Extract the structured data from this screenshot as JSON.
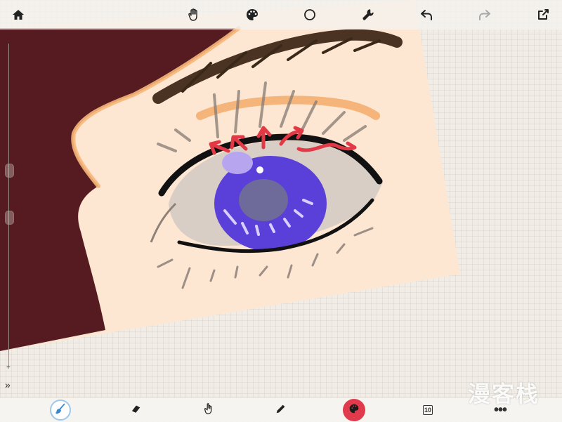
{
  "app": {
    "name": ""
  },
  "toolbar_top": {
    "icons": [
      "home-icon",
      "hand-icon",
      "palette-icon",
      "circle-icon",
      "wrench-icon",
      "undo-icon",
      "redo-icon",
      "share-icon"
    ]
  },
  "toolbar_bottom": {
    "icons": [
      "brush-icon",
      "eraser-icon",
      "smudge-icon",
      "pencil-icon",
      "color-icon",
      "layers-icon",
      "more-icon"
    ],
    "layers_count": "10",
    "more_label": "•••",
    "active_tool": "brush"
  },
  "side_slider": {
    "plus_label": "+",
    "collapse_label": "»"
  },
  "watermark": {
    "text": "漫客栈"
  },
  "colors": {
    "skin": "#fde6d2",
    "hair": "#561b20",
    "iris": "#5a3fd9",
    "arrows": "#e23946",
    "highlight_orange": "#f7b77a",
    "color_button": "#e03a4c"
  },
  "annotations": {
    "arrow_count": 5
  }
}
